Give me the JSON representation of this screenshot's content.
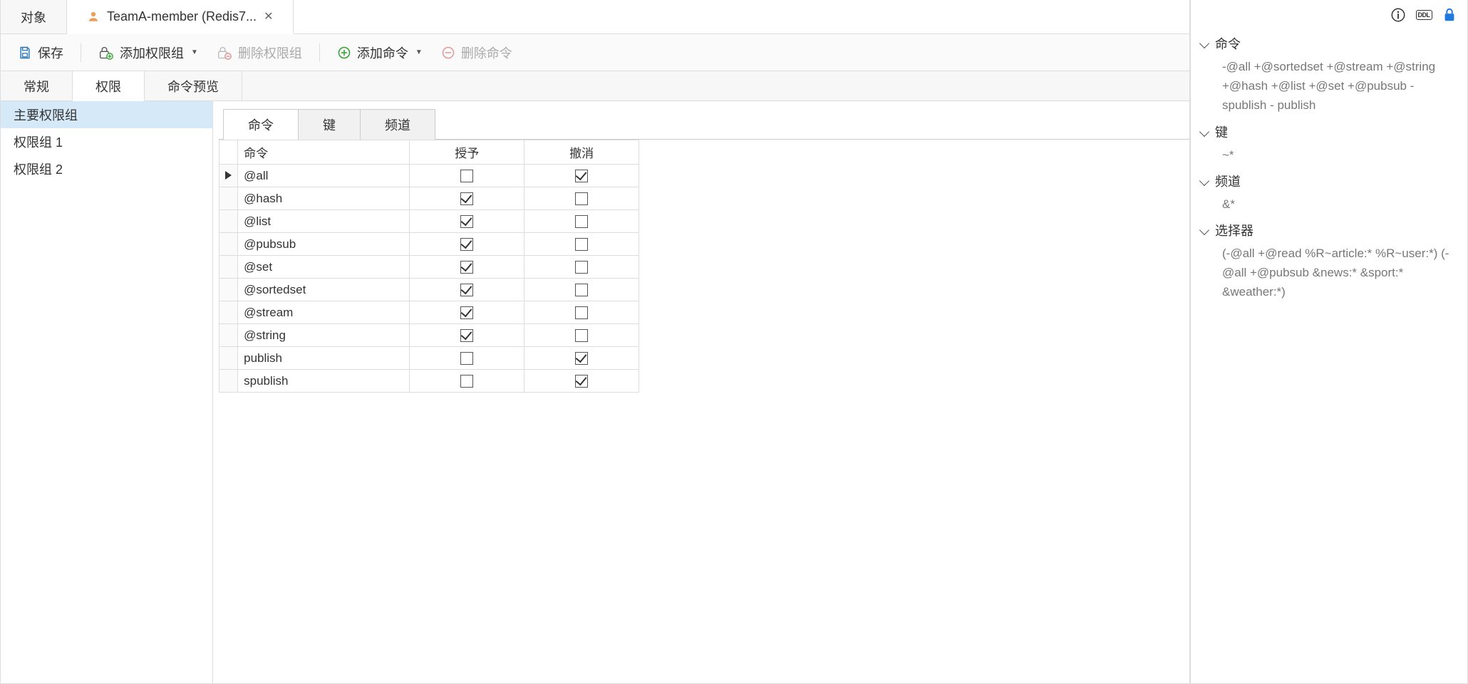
{
  "window_tabs": [
    {
      "label": "对象",
      "active": false,
      "has_icon": false,
      "closable": false
    },
    {
      "label": "TeamA-member (Redis7...",
      "active": true,
      "has_icon": true,
      "closable": true
    }
  ],
  "toolbar": {
    "save": "保存",
    "add_perm_group": "添加权限组",
    "del_perm_group": "删除权限组",
    "add_cmd": "添加命令",
    "del_cmd": "删除命令"
  },
  "sub_tabs": [
    {
      "label": "常规",
      "active": false
    },
    {
      "label": "权限",
      "active": true
    },
    {
      "label": "命令预览",
      "active": false
    }
  ],
  "perm_groups": [
    {
      "label": "主要权限组",
      "selected": true
    },
    {
      "label": "权限组 1",
      "selected": false
    },
    {
      "label": "权限组 2",
      "selected": false
    }
  ],
  "center_tabs": [
    {
      "label": "命令",
      "active": true
    },
    {
      "label": "键",
      "active": false
    },
    {
      "label": "频道",
      "active": false
    }
  ],
  "cmd_table": {
    "headers": {
      "cmd": "命令",
      "grant": "授予",
      "revoke": "撤消"
    },
    "rows": [
      {
        "cmd": "@all",
        "grant": false,
        "revoke": true,
        "current": true
      },
      {
        "cmd": "@hash",
        "grant": true,
        "revoke": false,
        "current": false
      },
      {
        "cmd": "@list",
        "grant": true,
        "revoke": false,
        "current": false
      },
      {
        "cmd": "@pubsub",
        "grant": true,
        "revoke": false,
        "current": false
      },
      {
        "cmd": "@set",
        "grant": true,
        "revoke": false,
        "current": false
      },
      {
        "cmd": "@sortedset",
        "grant": true,
        "revoke": false,
        "current": false
      },
      {
        "cmd": "@stream",
        "grant": true,
        "revoke": false,
        "current": false
      },
      {
        "cmd": "@string",
        "grant": true,
        "revoke": false,
        "current": false
      },
      {
        "cmd": "publish",
        "grant": false,
        "revoke": true,
        "current": false
      },
      {
        "cmd": "spublish",
        "grant": false,
        "revoke": true,
        "current": false
      }
    ]
  },
  "right_panel": {
    "sections": [
      {
        "title": "命令",
        "body": "-@all +@sortedset +@stream +@string +@hash +@list +@set +@pubsub -spublish - publish"
      },
      {
        "title": "键",
        "body": "~*"
      },
      {
        "title": "频道",
        "body": "&*"
      },
      {
        "title": "选择器",
        "body": "(-@all +@read %R~article:* %R~user:*) (-@all +@pubsub &news:* &sport:* &weather:*)"
      }
    ],
    "ddl_label": "DDL"
  }
}
